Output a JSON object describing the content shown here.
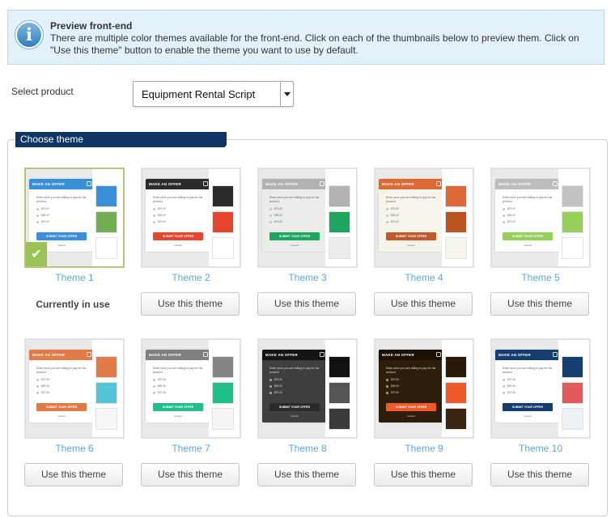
{
  "info": {
    "title": "Preview front-end",
    "text": "There are multiple color themes available for the front-end. Click on each of the thumbnails below to preview them. Click on \"Use this theme\" button to enable the theme you want to use by default.",
    "icon": "info-icon"
  },
  "product": {
    "label": "Select product",
    "selected": "Equipment Rental Script"
  },
  "panel": {
    "legend": "Choose theme"
  },
  "popup_text": {
    "title": "MAKE AN OFFER",
    "text": "Enter price you are willing to pay for the product",
    "prices": [
      "$70.00",
      "$90.00",
      "$70.00"
    ],
    "button": "SUBMIT YOUR OFFER",
    "cancel": "Cancel"
  },
  "use_label": "Use this theme",
  "current_label": "Currently in use",
  "themes": [
    {
      "name": "Theme 1",
      "active": true,
      "bg": "#ffffff",
      "header": "#3a8fd9",
      "btn": "#3a8fd9",
      "text": "#666666",
      "swatches": [
        "#3a8fd9",
        "#73ad53",
        "#ffffff"
      ]
    },
    {
      "name": "Theme 2",
      "active": false,
      "bg": "#ffffff",
      "header": "#2b2b2b",
      "btn": "#e8452f",
      "text": "#666666",
      "swatches": [
        "#2b2b2b",
        "#e8452f",
        "#ffffff"
      ]
    },
    {
      "name": "Theme 3",
      "active": false,
      "bg": "#ececea",
      "header": "#b2b2b2",
      "btn": "#1da65e",
      "text": "#666666",
      "swatches": [
        "#b2b2b2",
        "#1da65e",
        "#ececea"
      ]
    },
    {
      "name": "Theme 4",
      "active": false,
      "bg": "#f7f4ec",
      "header": "#dd6a36",
      "btn": "#c15a2a",
      "text": "#666666",
      "swatches": [
        "#dd6a36",
        "#b9541f",
        "#f7f4ec"
      ]
    },
    {
      "name": "Theme 5",
      "active": false,
      "bg": "#ffffff",
      "header": "#bdbdbd",
      "btn": "#95d05a",
      "text": "#666666",
      "swatches": [
        "#c2c2c2",
        "#95d05a",
        "#ffffff"
      ]
    },
    {
      "name": "Theme 6",
      "active": false,
      "bg": "#ffffff",
      "header": "#e07b48",
      "btn": "#e07b48",
      "text": "#666666",
      "swatches": [
        "#e07b48",
        "#55c4d9",
        "#f7f7f7"
      ]
    },
    {
      "name": "Theme 7",
      "active": false,
      "bg": "#ffffff",
      "header": "#7f7f7f",
      "btn": "#21be8b",
      "text": "#666666",
      "swatches": [
        "#858585",
        "#21be8b",
        "#f5f5f5"
      ]
    },
    {
      "name": "Theme 8",
      "active": false,
      "bg": "#3f3f3f",
      "header": "#141414",
      "btn": "#2a2a2a",
      "text": "#dddddd",
      "swatches": [
        "#111111",
        "#555555",
        "#3a3a3a"
      ]
    },
    {
      "name": "Theme 9",
      "active": false,
      "bg": "#2f1d0c",
      "header": "#1a0f05",
      "btn": "#ee5a28",
      "text": "#dddddd",
      "swatches": [
        "#2a1a08",
        "#ee5a28",
        "#3a2510"
      ]
    },
    {
      "name": "Theme 10",
      "active": false,
      "bg": "#ffffff",
      "header": "#153e70",
      "btn": "#153e70",
      "text": "#666666",
      "swatches": [
        "#153e70",
        "#e05a5a",
        "#eef1f4"
      ]
    }
  ]
}
